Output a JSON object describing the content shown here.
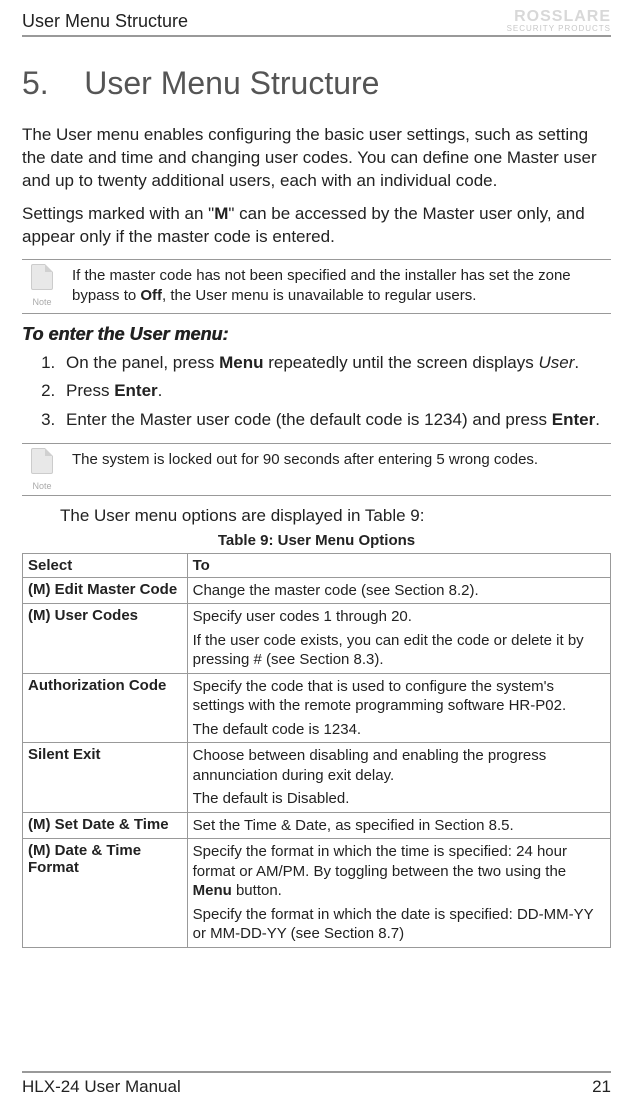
{
  "header": {
    "title": "User Menu Structure",
    "brand": "ROSSLARE",
    "brand_sub": "SECURITY PRODUCTS"
  },
  "section": {
    "number": "5.",
    "title": "User Menu Structure"
  },
  "paragraphs": {
    "p1": "The User menu enables configuring the basic user settings, such as setting the date and time and changing user codes. You can define one Master user and up to twenty additional users, each with an individual code.",
    "p2_a": "Settings marked with an \"",
    "p2_m": "M",
    "p2_b": "\" can be accessed by the Master user only, and appear only if the master code is entered."
  },
  "note1": {
    "label": "Note",
    "text_a": "If the master code has not been specified and the installer has set the zone bypass to ",
    "off": "Off",
    "text_b": ", the User menu is unavailable to regular users."
  },
  "subheading": "To enter the User menu:",
  "steps": {
    "s1_a": "On the panel, press ",
    "s1_menu": "Menu",
    "s1_b": " repeatedly until the screen displays ",
    "s1_user": "User",
    "s1_c": ".",
    "s2_a": "Press ",
    "s2_enter": "Enter",
    "s2_b": ".",
    "s3_a": "Enter the Master user code (the default code is 1234) and press ",
    "s3_enter": "Enter",
    "s3_b": "."
  },
  "note2": {
    "label": "Note",
    "text": "The system is locked out for 90 seconds after entering 5 wrong codes."
  },
  "table_intro": "The User menu options are displayed in Table 9:",
  "table_caption": "Table 9: User Menu Options",
  "table": {
    "head_select": "Select",
    "head_to": "To",
    "rows": [
      {
        "select": "(M) Edit Master Code",
        "to": [
          "Change the master code (see Section 8.2)."
        ]
      },
      {
        "select": "(M) User Codes",
        "to": [
          "Specify user codes 1 through 20.",
          "If the user code exists, you can edit the code or delete it by pressing # (see Section 8.3)."
        ]
      },
      {
        "select": "Authorization Code",
        "to": [
          "Specify the code that is used to configure the system's settings with the remote programming software HR-P02.",
          "The default code is 1234."
        ]
      },
      {
        "select": "Silent Exit",
        "to": [
          "Choose between disabling and enabling the progress annunciation during exit delay.",
          "The default is Disabled."
        ]
      },
      {
        "select": "(M) Set Date & Time",
        "to": [
          "Set the Time & Date, as specified in Section 8.5."
        ]
      },
      {
        "select": "(M) Date & Time Format",
        "to_parts": {
          "p1_a": "Specify the format in which the time is specified: 24 hour format or AM/PM. By toggling between the two using the ",
          "p1_menu": "Menu",
          "p1_b": " button.",
          "p2": "Specify the format in which the date is specified: DD-MM-YY or MM-DD-YY (see Section 8.7)"
        }
      }
    ]
  },
  "footer": {
    "manual": "HLX-24 User Manual",
    "page": "21"
  }
}
